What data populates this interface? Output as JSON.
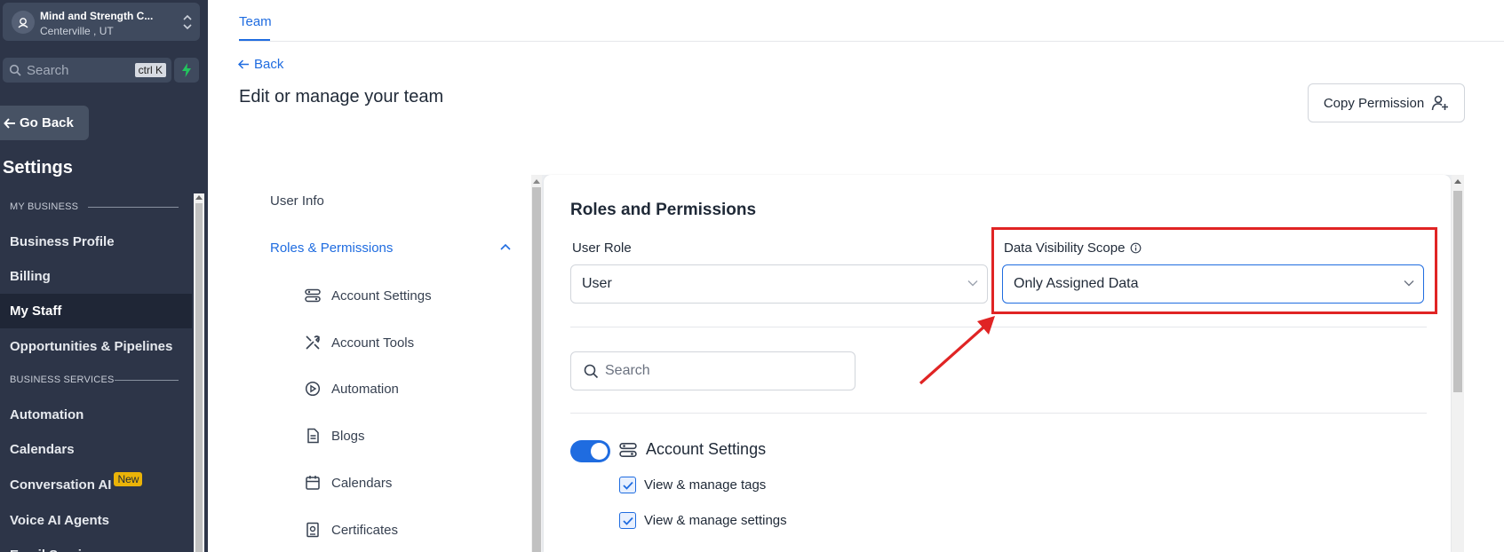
{
  "sidebar": {
    "location_name": "Mind and Strength C...",
    "location_sub": "Centerville , UT",
    "search_placeholder": "Search",
    "search_shortcut": "ctrl K",
    "go_back": "Go Back",
    "settings_title": "Settings",
    "section_my_business": "MY BUSINESS",
    "section_business_services": "BUSINESS SERVICES",
    "items": [
      {
        "label": "Business Profile"
      },
      {
        "label": "Billing"
      },
      {
        "label": "My Staff"
      },
      {
        "label": "Opportunities & Pipelines"
      },
      {
        "label": "Automation"
      },
      {
        "label": "Calendars"
      },
      {
        "label": "Conversation AI",
        "badge": "New"
      },
      {
        "label": "Voice AI Agents"
      },
      {
        "label": "Email Services"
      }
    ]
  },
  "header": {
    "tab": "Team",
    "back": "Back",
    "page_title": "Edit or manage your team",
    "copy_permission": "Copy Permission"
  },
  "subnav": {
    "items": [
      {
        "label": "User Info"
      },
      {
        "label": "Roles & Permissions"
      },
      {
        "label": "Account Settings"
      },
      {
        "label": "Account Tools"
      },
      {
        "label": "Automation"
      },
      {
        "label": "Blogs"
      },
      {
        "label": "Calendars"
      },
      {
        "label": "Certificates"
      }
    ]
  },
  "panel": {
    "title": "Roles and Permissions",
    "user_role_label": "User Role",
    "user_role_value": "User",
    "data_scope_label": "Data Visibility Scope",
    "data_scope_value": "Only Assigned Data",
    "search_placeholder": "Search",
    "group_label": "Account Settings",
    "group_enabled": true,
    "permissions": [
      {
        "label": "View & manage tags",
        "checked": true
      },
      {
        "label": "View & manage settings",
        "checked": true
      }
    ]
  },
  "colors": {
    "accent": "#1f6ce0",
    "sidebar_bg": "#2d3548",
    "annotation": "#e02424"
  }
}
